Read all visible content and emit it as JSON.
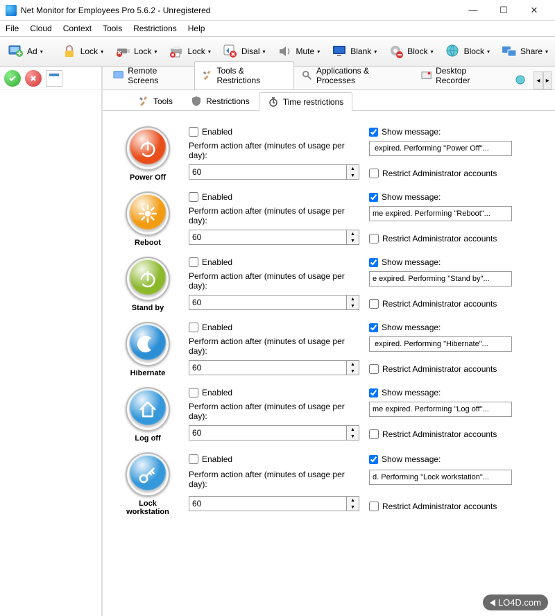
{
  "window": {
    "title": "Net Monitor for Employees Pro 5.6.2 - Unregistered"
  },
  "menu": [
    "File",
    "Cloud",
    "Context",
    "Tools",
    "Restrictions",
    "Help"
  ],
  "toolbar": [
    {
      "label": "Ad",
      "icon": "monitor-add"
    },
    {
      "label": "Lock",
      "icon": "padlock"
    },
    {
      "label": "Lock",
      "icon": "usb-lock"
    },
    {
      "label": "Lock",
      "icon": "printer-lock"
    },
    {
      "label": "Disal",
      "icon": "shortcut-disable"
    },
    {
      "label": "Mute",
      "icon": "speaker-mute"
    },
    {
      "label": "Blank",
      "icon": "monitor-blank"
    },
    {
      "label": "Block",
      "icon": "gear-block"
    },
    {
      "label": "Block",
      "icon": "globe-block"
    },
    {
      "label": "Share",
      "icon": "monitors-share"
    }
  ],
  "mainTabs": [
    {
      "label": "Remote Screens",
      "active": false,
      "icon": "monitor"
    },
    {
      "label": "Tools & Restrictions",
      "active": true,
      "icon": "tools"
    },
    {
      "label": "Applications & Processes",
      "active": false,
      "icon": "search"
    },
    {
      "label": "Desktop Recorder",
      "active": false,
      "icon": "recorder"
    }
  ],
  "subTabs": [
    {
      "label": "Tools",
      "active": false,
      "icon": "tools"
    },
    {
      "label": "Restrictions",
      "active": false,
      "icon": "shield"
    },
    {
      "label": "Time restrictions",
      "active": true,
      "icon": "stopwatch"
    }
  ],
  "commonLabels": {
    "enabled": "Enabled",
    "perform": "Perform action after (minutes of usage per day):",
    "showMessage": "Show message:",
    "restrictAdmin": "Restrict Administrator accounts"
  },
  "actions": [
    {
      "name": "Power Off",
      "color": "#e94e1b",
      "icon": "power",
      "enabled": false,
      "minutes": "60",
      "showMsg": true,
      "message": " expired. Performing \"Power Off\"...",
      "restrictAdmin": false
    },
    {
      "name": "Reboot",
      "color": "#f39c12",
      "icon": "reboot",
      "enabled": false,
      "minutes": "60",
      "showMsg": true,
      "message": "me expired. Performing \"Reboot\"...",
      "restrictAdmin": false
    },
    {
      "name": "Stand by",
      "color": "#8cb82b",
      "icon": "power",
      "enabled": false,
      "minutes": "60",
      "showMsg": true,
      "message": "e expired. Performing \"Stand by\"...",
      "restrictAdmin": false
    },
    {
      "name": "Hibernate",
      "color": "#2c8fd6",
      "icon": "moon",
      "enabled": false,
      "minutes": "60",
      "showMsg": true,
      "message": " expired. Performing \"Hibernate\"...",
      "restrictAdmin": false
    },
    {
      "name": "Log off",
      "color": "#3498db",
      "icon": "home",
      "enabled": false,
      "minutes": "60",
      "showMsg": true,
      "message": "me expired. Performing \"Log off\"...",
      "restrictAdmin": false
    },
    {
      "name": "Lock workstation",
      "color": "#3498db",
      "icon": "key",
      "enabled": false,
      "minutes": "60",
      "showMsg": true,
      "message": "d. Performing \"Lock workstation\"...",
      "restrictAdmin": false
    }
  ],
  "watermark": "LO4D.com"
}
